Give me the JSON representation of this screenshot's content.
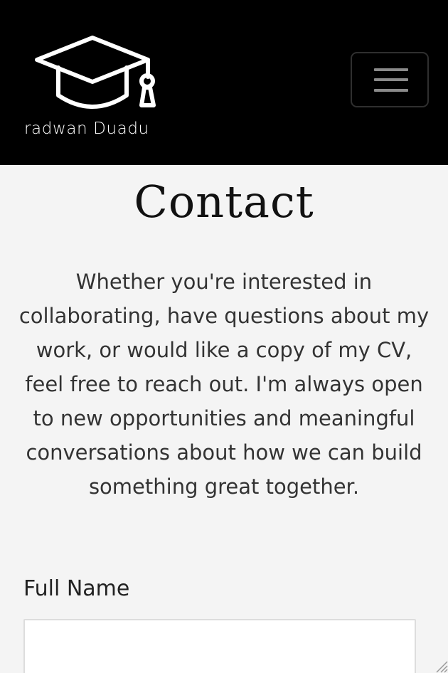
{
  "navbar": {
    "brand_name": "radwan Duadu",
    "logo_icon": "graduation-cap-icon",
    "toggle_icon": "hamburger-menu-icon",
    "background": "#000000"
  },
  "main": {
    "title": "Contact",
    "intro": "Whether you're interested in collaborating, have questions about my work, or would like a copy of my CV, feel free to reach out. I'm always open to new opportunities and meaningful conversations about how we can build something great together."
  },
  "form": {
    "full_name_label": "Full Name",
    "full_name_value": ""
  }
}
